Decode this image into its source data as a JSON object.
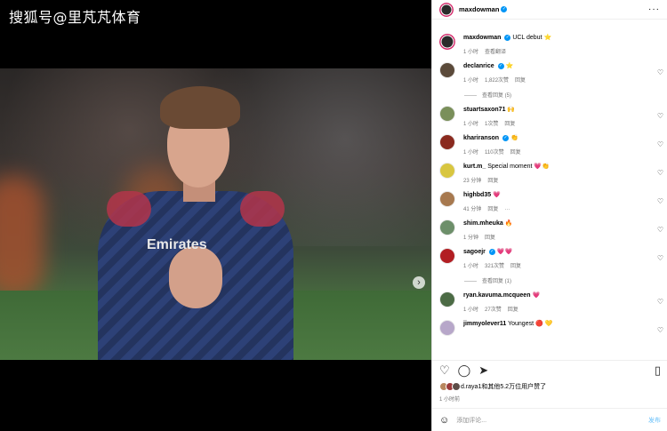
{
  "watermark": "搜狐号@里芃芃体育",
  "media": {
    "jersey_sponsor": "Emirates",
    "next_icon": "chevron-right-icon",
    "slide_count": 3,
    "active_slide": 0
  },
  "header": {
    "username": "maxdowman",
    "more": "···"
  },
  "caption": {
    "username": "maxdowman",
    "text": "UCL debut",
    "emoji": "⭐",
    "time": "1 小时",
    "translate": "查看翻译"
  },
  "comments": [
    {
      "username": "declanrice",
      "verified": true,
      "text": "⭐",
      "time": "1 小时",
      "likes": "1,822次赞",
      "reply": "回复",
      "view_replies": "查看回复 (5)",
      "avatar_color": "#5b4a3a"
    },
    {
      "username": "stuartsaxon71",
      "verified": false,
      "text": "🙌",
      "time": "1 小时",
      "likes": "1次赞",
      "reply": "回复",
      "avatar_color": "#7a8f5a"
    },
    {
      "username": "khariranson",
      "verified": true,
      "text": "👏",
      "time": "1 小时",
      "likes": "110次赞",
      "reply": "回复",
      "avatar_color": "#8a2a1f"
    },
    {
      "username": "kurt.m_",
      "verified": false,
      "text": "Special moment 💗👏",
      "time": "23 分钟",
      "likes": "",
      "reply": "回复",
      "avatar_color": "#d8c640"
    },
    {
      "username": "highbd35",
      "verified": false,
      "text": "💗",
      "time": "41 分钟",
      "likes": "",
      "reply": "回复",
      "extra": "···",
      "avatar_color": "#a7794f"
    },
    {
      "username": "shim.mheuka",
      "verified": false,
      "text": "🔥",
      "time": "1 分钟",
      "likes": "",
      "reply": "回复",
      "avatar_color": "#6d8f6a"
    },
    {
      "username": "sagoejr",
      "verified": true,
      "text": "💗💗",
      "time": "1 小时",
      "likes": "321次赞",
      "reply": "回复",
      "view_replies": "查看回复 (1)",
      "avatar_color": "#b21e23"
    },
    {
      "username": "ryan.kavuma.mcqueen",
      "verified": false,
      "text": "💗",
      "time": "1 小时",
      "likes": "27次赞",
      "reply": "回复",
      "avatar_color": "#4c6b45"
    },
    {
      "username": "jimmyolever11",
      "verified": false,
      "text": "Youngest 🔴 💛",
      "time": "",
      "likes": "",
      "reply": "",
      "avatar_color": "#b7a7c9"
    }
  ],
  "actions": {
    "like_icon": "heart-outline-icon",
    "comment_icon": "comment-icon",
    "share_icon": "send-icon",
    "save_icon": "bookmark-icon"
  },
  "likes": {
    "text": "d.raya1和其他5.2万位用户赞了",
    "avatar_colors": [
      "#b8875e",
      "#9c3a3a",
      "#5d4d48"
    ]
  },
  "posted_time": "1 小时前",
  "add_comment": {
    "placeholder": "添加评论...",
    "post": "发布",
    "emoji_icon": "emoji-smile-icon"
  }
}
